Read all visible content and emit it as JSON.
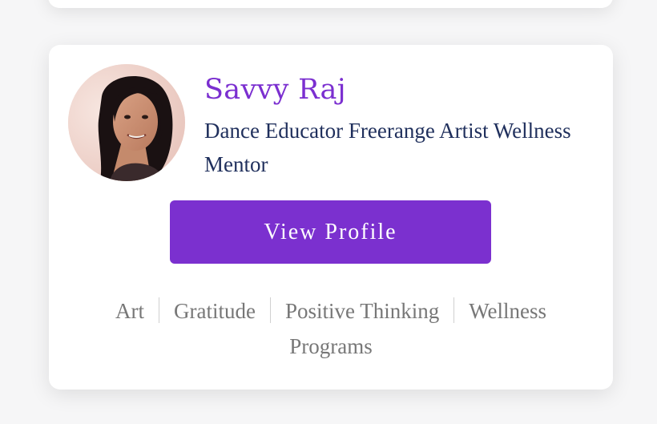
{
  "profile": {
    "name": "Savvy Raj",
    "bio": "Dance Educator Freerange Artist Wellness Mentor",
    "view_profile_label": "View Profile"
  },
  "tags": [
    {
      "label": "Art"
    },
    {
      "label": "Gratitude"
    },
    {
      "label": "Positive Thinking"
    },
    {
      "label": "Wellness"
    },
    {
      "label": "Programs"
    }
  ],
  "colors": {
    "accent": "#7b30cf",
    "name_text": "#7b2fd0",
    "bio_text": "#1f2f5c",
    "tag_text": "#777777"
  },
  "icons": {
    "avatar": "profile-photo"
  }
}
